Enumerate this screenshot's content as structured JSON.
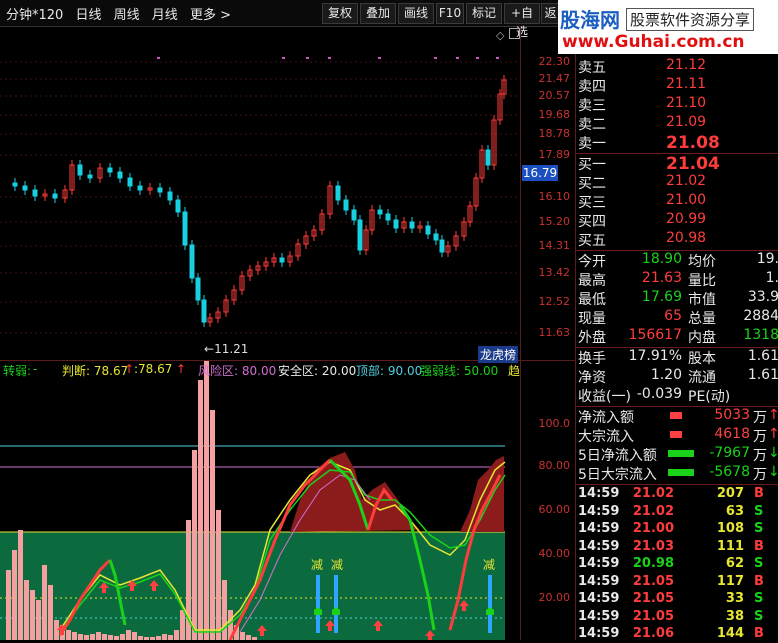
{
  "toolbar": {
    "period": "分钟*120",
    "day": "日线",
    "week": "周线",
    "month": "月线",
    "more": "更多 >",
    "buttons": [
      "复权",
      "叠加",
      "画线",
      "F10",
      "标记",
      "+自选",
      "返"
    ]
  },
  "logo": {
    "brand": "股海网",
    "slogan": "股票软件资源分享",
    "url": "www.Guhai.com.cn"
  },
  "price_axis": [
    "22.30",
    "21.47",
    "20.57",
    "19.68",
    "18.78",
    "17.89",
    "16.79",
    "16.10",
    "15.20",
    "14.31",
    "13.42",
    "12.52",
    "11.63"
  ],
  "current_price_tag": "16.79",
  "low_marker": "11.21",
  "list_tag": "龙虎榜",
  "indicator": {
    "name": "转弱:",
    "name_val": "-",
    "judge": "判断: 78.67",
    "arrow1": "↑",
    "judge2": ":78.67",
    "arrow2": "↑",
    "risk": "风险区: 80.00",
    "safe": "安全区: 20.00",
    "top": "顶部: 90.00",
    "strong": "强弱线: 50.00",
    "trend": "趋"
  },
  "ind_axis": [
    "100.0",
    "80.00",
    "60.00",
    "40.00",
    "20.00"
  ],
  "minus_labels": [
    "减",
    "减",
    "减"
  ],
  "order_book": {
    "sell": [
      {
        "label": "卖五",
        "price": "21.12"
      },
      {
        "label": "卖四",
        "price": "21.11"
      },
      {
        "label": "卖三",
        "price": "21.10"
      },
      {
        "label": "卖二",
        "price": "21.09"
      },
      {
        "label": "卖一",
        "price": "21.08"
      }
    ],
    "buy": [
      {
        "label": "买一",
        "price": "21.04"
      },
      {
        "label": "买二",
        "price": "21.02"
      },
      {
        "label": "买三",
        "price": "21.00"
      },
      {
        "label": "买四",
        "price": "20.99"
      },
      {
        "label": "买五",
        "price": "20.98"
      }
    ]
  },
  "quote": [
    {
      "k1": "今开",
      "v1": "18.90",
      "k2": "均价",
      "v2": "19."
    },
    {
      "k1": "最高",
      "v1": "21.63",
      "k2": "量比",
      "v2": "1."
    },
    {
      "k1": "最低",
      "v1": "17.69",
      "k2": "市值",
      "v2": "33.9"
    },
    {
      "k1": "现量",
      "v1": "65",
      "k2": "总量",
      "v2": "2884"
    },
    {
      "k1": "外盘",
      "v1": "156617",
      "k2": "内盘",
      "v2": "1318"
    }
  ],
  "fund": [
    {
      "k1": "换手",
      "v1": "17.91%",
      "k2": "股本",
      "v2": "1.61"
    },
    {
      "k1": "净资",
      "v1": "1.20",
      "k2": "流通",
      "v2": "1.61"
    },
    {
      "k1": "收益(一)",
      "v1": "-0.039",
      "k2": "PE(动)",
      "v2": ""
    }
  ],
  "flows": [
    {
      "label": "净流入额",
      "value": "5033",
      "unit": "万",
      "dir": "up",
      "color": "#ff4040"
    },
    {
      "label": "大宗流入",
      "value": "4618",
      "unit": "万",
      "dir": "up",
      "color": "#ff4040"
    },
    {
      "label": "5日净流入额",
      "value": "-7967",
      "unit": "万",
      "dir": "down",
      "color": "#19d219"
    },
    {
      "label": "5日大宗流入",
      "value": "-5678",
      "unit": "万",
      "dir": "down",
      "color": "#19d219"
    }
  ],
  "trades": [
    {
      "time": "14:59",
      "price": "21.02",
      "vol": "207",
      "side": "B"
    },
    {
      "time": "14:59",
      "price": "21.02",
      "vol": "63",
      "side": "S"
    },
    {
      "time": "14:59",
      "price": "21.00",
      "vol": "108",
      "side": "S"
    },
    {
      "time": "14:59",
      "price": "21.03",
      "vol": "111",
      "side": "B"
    },
    {
      "time": "14:59",
      "price": "20.98",
      "vol": "62",
      "side": "S"
    },
    {
      "time": "14:59",
      "price": "21.05",
      "vol": "117",
      "side": "B"
    },
    {
      "time": "14:59",
      "price": "21.05",
      "vol": "33",
      "side": "S"
    },
    {
      "time": "14:59",
      "price": "21.05",
      "vol": "38",
      "side": "S"
    },
    {
      "time": "14:59",
      "price": "21.06",
      "vol": "144",
      "side": "B"
    }
  ]
}
